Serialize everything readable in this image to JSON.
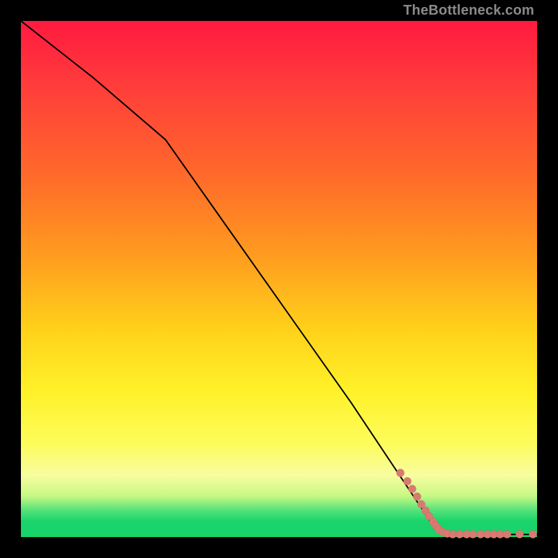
{
  "watermark": "TheBottleneck.com",
  "colors": {
    "marker": "#d97a72",
    "line": "#000000"
  },
  "chart_data": {
    "type": "line",
    "title": "",
    "xlabel": "",
    "ylabel": "",
    "xlim": [
      0,
      100
    ],
    "ylim": [
      0,
      100
    ],
    "grid": false,
    "series": [
      {
        "name": "bottleneck-curve",
        "description": "Black curve descending from top-left, steepening after a knee around x≈28, dropping to near zero around x≈80 and flattening along the bottom through x=100.",
        "points": [
          {
            "x": 0,
            "y": 100
          },
          {
            "x": 14,
            "y": 89
          },
          {
            "x": 28,
            "y": 77
          },
          {
            "x": 40,
            "y": 60
          },
          {
            "x": 52,
            "y": 43
          },
          {
            "x": 64,
            "y": 26
          },
          {
            "x": 74,
            "y": 11
          },
          {
            "x": 78,
            "y": 5
          },
          {
            "x": 80,
            "y": 2
          },
          {
            "x": 84,
            "y": 0.8
          },
          {
            "x": 90,
            "y": 0.5
          },
          {
            "x": 100,
            "y": 0.5
          }
        ]
      },
      {
        "name": "data-markers",
        "description": "Salmon circular markers scattered along the lower-right portion of the curve, densest near the knee at x≈76–82 and along the flat bottom edge.",
        "points": [
          {
            "x": 73.5,
            "y": 12.5
          },
          {
            "x": 74.8,
            "y": 10.8
          },
          {
            "x": 75.8,
            "y": 9.3
          },
          {
            "x": 76.8,
            "y": 7.8
          },
          {
            "x": 77.6,
            "y": 6.4
          },
          {
            "x": 78.4,
            "y": 5.1
          },
          {
            "x": 79.1,
            "y": 4.0
          },
          {
            "x": 79.8,
            "y": 3.0
          },
          {
            "x": 80.4,
            "y": 2.2
          },
          {
            "x": 81.0,
            "y": 1.5
          },
          {
            "x": 81.8,
            "y": 1.0
          },
          {
            "x": 82.6,
            "y": 0.7
          },
          {
            "x": 83.6,
            "y": 0.5
          },
          {
            "x": 85.0,
            "y": 0.5
          },
          {
            "x": 86.4,
            "y": 0.5
          },
          {
            "x": 87.6,
            "y": 0.5
          },
          {
            "x": 89.0,
            "y": 0.5
          },
          {
            "x": 90.4,
            "y": 0.5
          },
          {
            "x": 91.6,
            "y": 0.5
          },
          {
            "x": 92.8,
            "y": 0.5
          },
          {
            "x": 94.2,
            "y": 0.5
          },
          {
            "x": 96.6,
            "y": 0.5
          },
          {
            "x": 99.2,
            "y": 0.5
          }
        ]
      }
    ]
  }
}
